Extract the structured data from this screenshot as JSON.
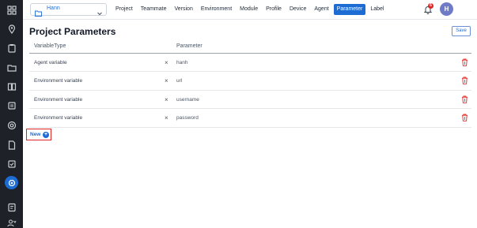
{
  "sidebar": {
    "icons": [
      "grid-icon",
      "location-icon",
      "clipboard-icon",
      "folder-icon",
      "book-icon",
      "layers-icon",
      "target-icon",
      "file-icon",
      "checklist-icon",
      "settings-icon",
      "report-icon",
      "users-icon"
    ],
    "active": "settings-icon"
  },
  "header": {
    "project_select": {
      "value": "Hann"
    },
    "nav": [
      "Project",
      "Teammate",
      "Version",
      "Environment",
      "Module",
      "Profile",
      "Device",
      "Agent",
      "Parameter",
      "Label"
    ],
    "active_nav": "Parameter",
    "notification_count": "6",
    "avatar_initial": "H"
  },
  "main": {
    "title": "Project Parameters",
    "save_label": "Save",
    "columns": [
      "VariableType",
      "Parameter"
    ],
    "rows": [
      {
        "type": "Agent variable",
        "parameter": "hanh"
      },
      {
        "type": "Environment variable",
        "parameter": "url"
      },
      {
        "type": "Environment variable",
        "parameter": "username"
      },
      {
        "type": "Environment variable",
        "parameter": "password"
      }
    ],
    "clear_symbol": "×",
    "new_label": "New",
    "new_plus": "+"
  },
  "colors": {
    "accent": "#1c6cd4",
    "sidebar": "#1f2128",
    "danger": "#dc2626"
  }
}
